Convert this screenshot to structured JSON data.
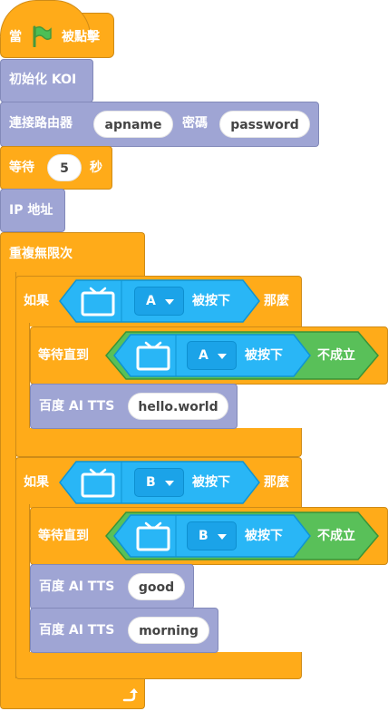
{
  "workspace": {
    "hat": {
      "prefix": "當",
      "suffix": "被點擊",
      "flag_icon": "green-flag-icon"
    },
    "init_koi": "初始化 KOI",
    "connect": {
      "label": "連接路由器",
      "ssid": "apname",
      "pwd_label": "密碼",
      "pwd": "password"
    },
    "wait": {
      "label": "等待",
      "value": "5",
      "unit": "秒"
    },
    "ip": "IP 地址",
    "forever": {
      "label": "重複無限次",
      "loop_icon": "loop-arrow-icon"
    },
    "if1": {
      "if_label": "如果",
      "then_label": "那麼",
      "sensor_icon": "tv-screen-icon",
      "button": "A",
      "pressed": "被按下",
      "wait_until": "等待直到",
      "not_label": "不成立",
      "tts_label": "百度 AI TTS",
      "tts_text": "hello.world"
    },
    "if2": {
      "if_label": "如果",
      "then_label": "那麼",
      "sensor_icon": "tv-screen-icon",
      "button": "B",
      "pressed": "被按下",
      "wait_until": "等待直到",
      "not_label": "不成立",
      "tts_label": "百度 AI TTS",
      "tts1_text": "good",
      "tts2_text": "morning"
    }
  },
  "colors": {
    "events": "#ffab19",
    "koi": "#9fa5d4",
    "sensor": "#29b6f6",
    "operator": "#59c059"
  }
}
